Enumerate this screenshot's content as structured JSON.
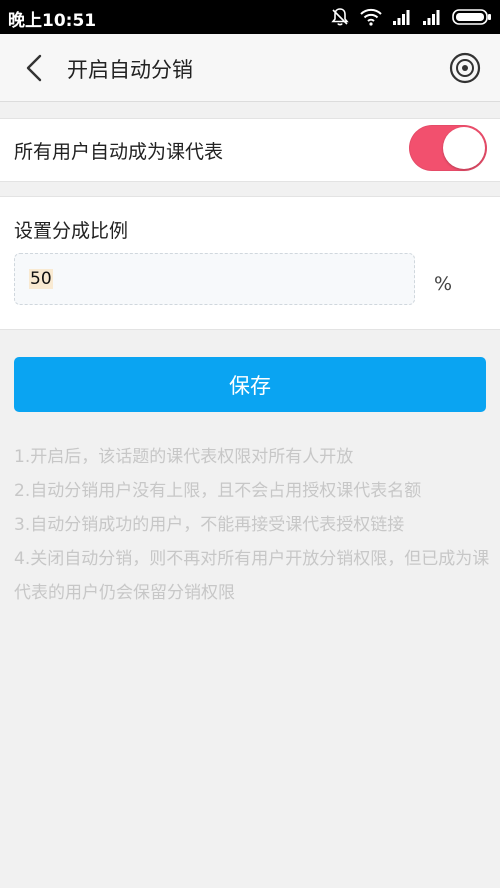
{
  "status_bar": {
    "time": "晚上10:51"
  },
  "header": {
    "title": "开启自动分销"
  },
  "toggle_row": {
    "label": "所有用户自动成为课代表",
    "enabled": true,
    "on_color": "#f2506e"
  },
  "ratio": {
    "label": "设置分成比例",
    "value": "50",
    "unit": "%"
  },
  "actions": {
    "save_label": "保存",
    "save_color": "#0aa4f2"
  },
  "notes": [
    "1.开启后，该话题的课代表权限对所有人开放",
    "2.自动分销用户没有上限，且不会占用授权课代表名额",
    "3.自动分销成功的用户，不能再接受课代表授权链接",
    "4.关闭自动分销，则不再对所有用户开放分销权限，但已成为课代表的用户仍会保留分销权限"
  ]
}
